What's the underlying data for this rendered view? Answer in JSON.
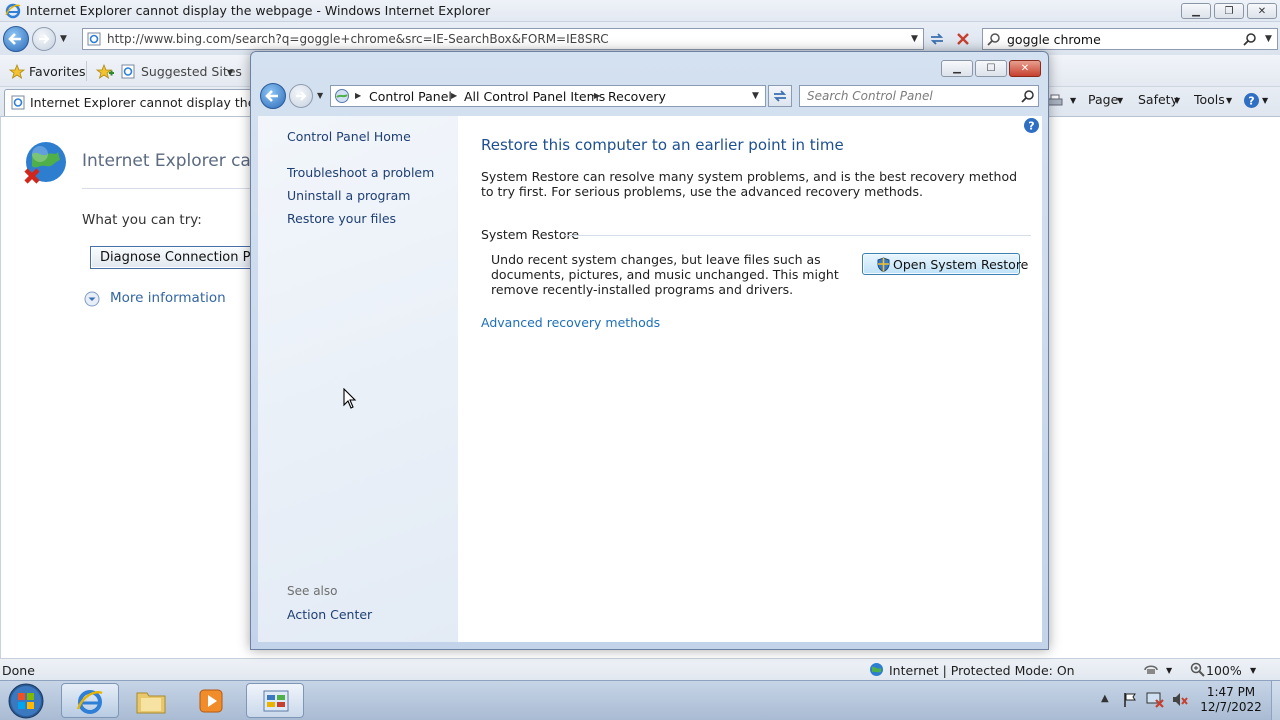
{
  "ie": {
    "title": "Internet Explorer cannot display the webpage - Windows Internet Explorer",
    "address": "http://www.bing.com/search?q=goggle+chrome&src=IE-SearchBox&FORM=IE8SRC",
    "search_query": "goggle chrome",
    "favorites_label": "Favorites",
    "suggested_sites_label": "Suggested Sites",
    "tab_title": "Internet Explorer cannot display the webpa",
    "command_bar": {
      "page": "Page",
      "safety": "Safety",
      "tools": "Tools"
    },
    "error_page": {
      "title": "Internet Explorer cann",
      "what_you_can_try": "What you can try:",
      "diagnose_button": "Diagnose Connection Prob",
      "more_information": "More information"
    },
    "status": {
      "left": "Done",
      "zone": "Internet | Protected Mode: On",
      "zoom": "100%"
    }
  },
  "control_panel": {
    "breadcrumbs": [
      "Control Panel",
      "All Control Panel Items",
      "Recovery"
    ],
    "search_placeholder": "Search Control Panel",
    "sidebar": {
      "home": "Control Panel Home",
      "links": [
        "Troubleshoot a problem",
        "Uninstall a program",
        "Restore your files"
      ],
      "see_also": "See also",
      "action_center": "Action Center"
    },
    "main": {
      "heading": "Restore this computer to an earlier point in time",
      "description": "System Restore can resolve many system problems, and is the best recovery method to try first. For serious problems, use the advanced recovery methods.",
      "system_restore_label": "System Restore",
      "system_restore_desc": "Undo recent system changes, but leave files such as documents, pictures, and music unchanged. This might remove recently-installed programs and drivers.",
      "open_system_restore": "Open System Restore",
      "advanced_link": "Advanced recovery methods"
    }
  },
  "taskbar": {
    "time": "1:47 PM",
    "date": "12/7/2022"
  },
  "colors": {
    "link_blue": "#1e6fb8",
    "heading_blue": "#1d4f91",
    "close_red": "#c7402f"
  }
}
